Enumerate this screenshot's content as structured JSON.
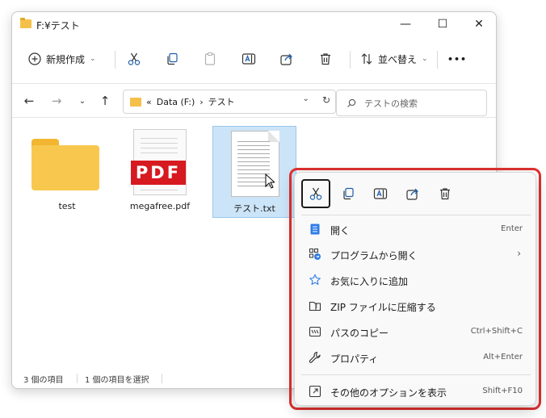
{
  "window": {
    "title": "F:¥テスト",
    "minimize_glyph": "—",
    "maximize_glyph": "☐",
    "close_glyph": "✕"
  },
  "toolbar": {
    "new_label": "新規作成",
    "sort_label": "並べ替え",
    "more_glyph": "•••"
  },
  "address": {
    "overflow": "«",
    "drive": "Data (F:)",
    "separator": "›",
    "folder": "テスト",
    "search_placeholder": "テストの検索"
  },
  "files": [
    {
      "name": "test",
      "type": "folder"
    },
    {
      "name": "megafree.pdf",
      "type": "pdf",
      "badge": "PDF"
    },
    {
      "name": "テスト.txt",
      "type": "txt"
    }
  ],
  "status": {
    "item_count": "3 個の項目",
    "selected_count": "1 個の項目を選択"
  },
  "context_menu": {
    "items": [
      {
        "label": "開く",
        "shortcut": "Enter",
        "icon": "notepad-icon"
      },
      {
        "label": "プログラムから開く",
        "shortcut": "",
        "icon": "open-with-icon"
      },
      {
        "label": "お気に入りに追加",
        "shortcut": "",
        "icon": "star-icon"
      },
      {
        "label": "ZIP ファイルに圧縮する",
        "shortcut": "",
        "icon": "zip-icon"
      },
      {
        "label": "パスのコピー",
        "shortcut": "Ctrl+Shift+C",
        "icon": "copy-path-icon"
      },
      {
        "label": "プロパティ",
        "shortcut": "Alt+Enter",
        "icon": "wrench-icon"
      },
      {
        "label": "その他のオプションを表示",
        "shortcut": "Shift+F10",
        "icon": "more-options-icon"
      }
    ],
    "submenu_arrow": "›"
  },
  "colors": {
    "accent": "#005fb8",
    "selection_bg": "#cce4f7",
    "highlight_outline": "#e03030",
    "folder": "#f8c84e",
    "pdf_red": "#d71920"
  }
}
